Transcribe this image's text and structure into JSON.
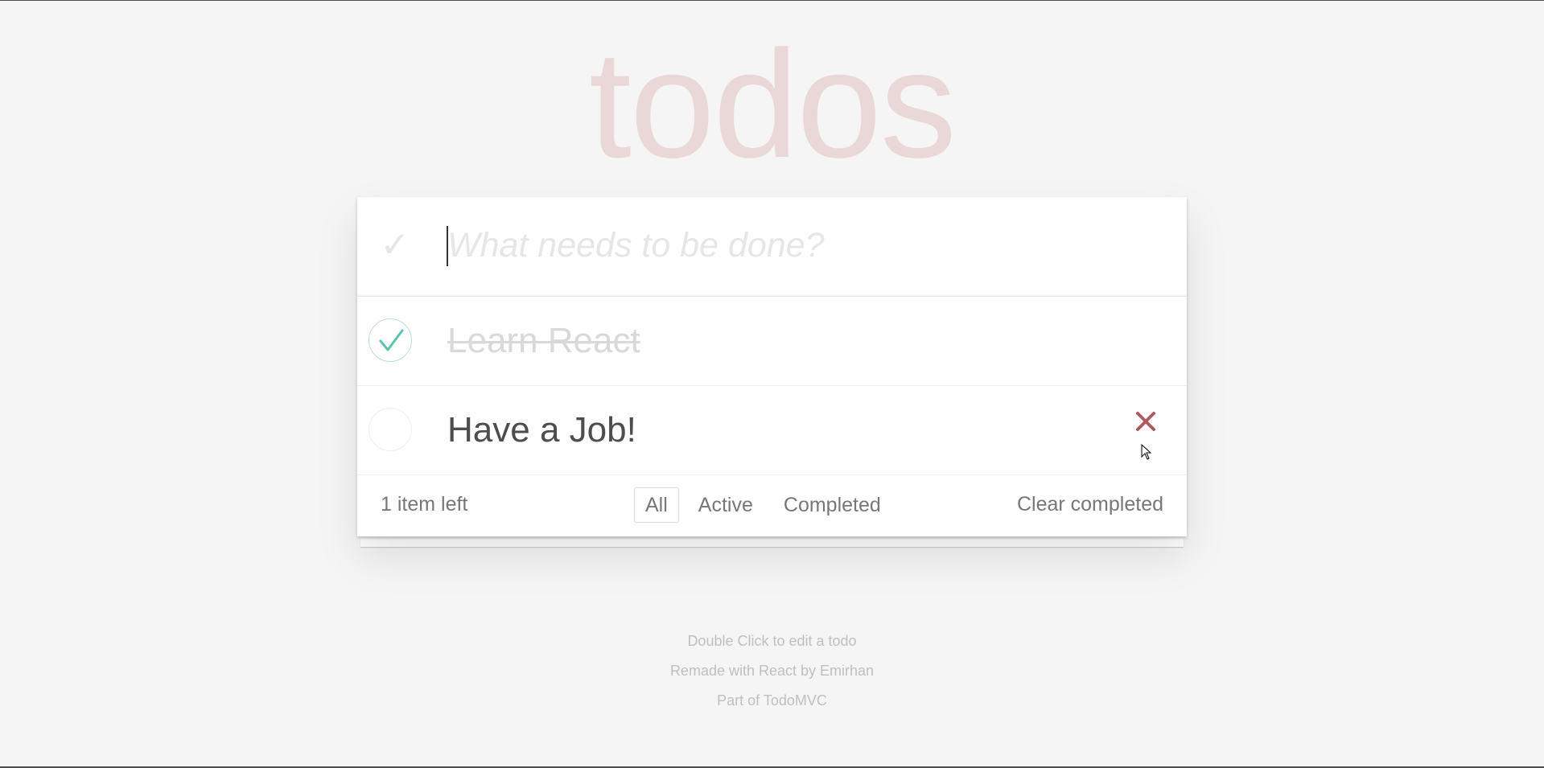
{
  "app": {
    "title": "todos"
  },
  "header": {
    "toggle_all_glyph": "✓",
    "new_todo_placeholder": "What needs to be done?",
    "new_todo_value": ""
  },
  "todos": [
    {
      "label": "Learn React",
      "completed": true
    },
    {
      "label": "Have a Job!",
      "completed": false
    }
  ],
  "footer": {
    "count_text": "1 item left",
    "filters": [
      {
        "label": "All",
        "selected": true
      },
      {
        "label": "Active",
        "selected": false
      },
      {
        "label": "Completed",
        "selected": false
      }
    ],
    "clear_completed_label": "Clear completed"
  },
  "info": {
    "line1": "Double Click to edit a todo",
    "line2": "Remade with React by Emirhan",
    "line3": "Part of TodoMVC"
  },
  "colors": {
    "background": "#f5f5f5",
    "title": "#eacaca",
    "check_done": "#5dc2af",
    "destroy": "#af5b5e",
    "text": "#4d4d4d",
    "muted_text": "#777777"
  },
  "icons": {
    "toggle_all": "checkmark-icon",
    "completed_check": "checkmark-icon",
    "destroy": "close-icon",
    "cursor": "mouse-pointer-icon"
  }
}
